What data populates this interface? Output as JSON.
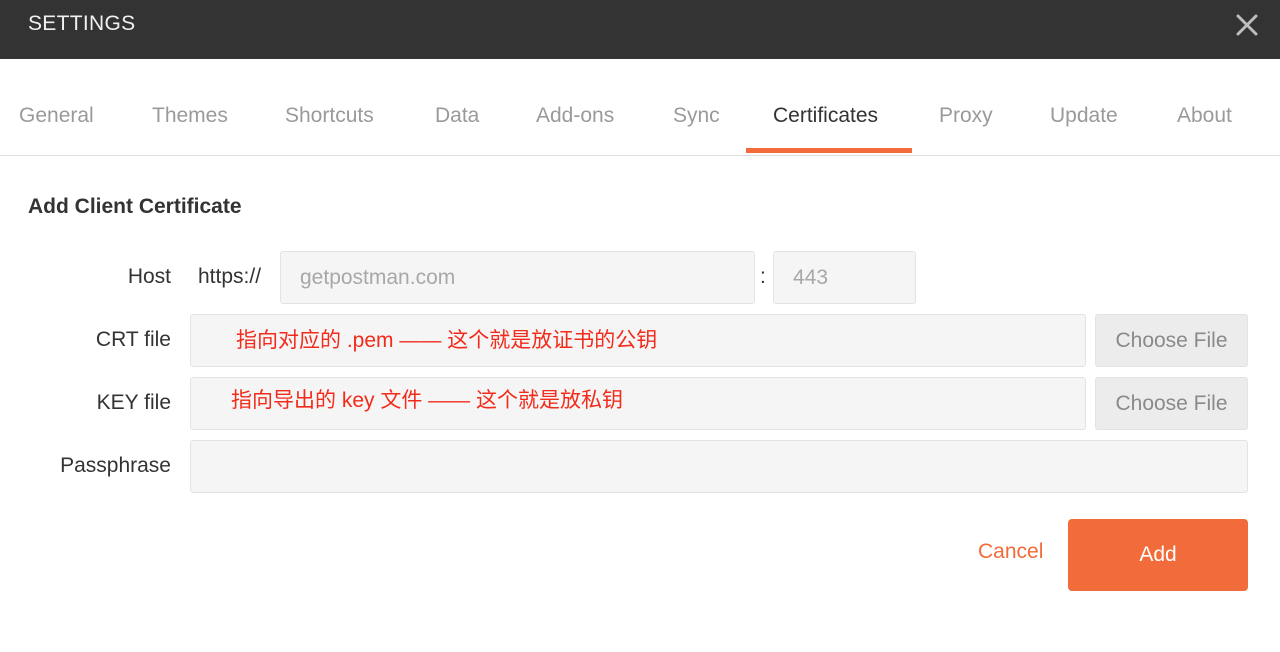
{
  "window": {
    "title": "SETTINGS",
    "close_icon": "close-icon"
  },
  "tabs": [
    {
      "label": "General"
    },
    {
      "label": "Themes"
    },
    {
      "label": "Shortcuts"
    },
    {
      "label": "Data"
    },
    {
      "label": "Add-ons"
    },
    {
      "label": "Sync"
    },
    {
      "label": "Certificates",
      "active": true
    },
    {
      "label": "Proxy"
    },
    {
      "label": "Update"
    },
    {
      "label": "About"
    }
  ],
  "form": {
    "section_title": "Add Client Certificate",
    "host": {
      "label": "Host",
      "prefix": "https://",
      "placeholder": "getpostman.com",
      "separator": ":",
      "port_placeholder": "443"
    },
    "crt": {
      "label": "CRT file",
      "annotation": "指向对应的 .pem  —— 这个就是放证书的公钥",
      "button": "Choose File"
    },
    "key": {
      "label": "KEY file",
      "annotation": "指向导出的 key 文件  —— 这个就是放私钥",
      "button": "Choose File"
    },
    "passphrase": {
      "label": "Passphrase",
      "value": ""
    }
  },
  "actions": {
    "cancel": "Cancel",
    "add": "Add"
  },
  "colors": {
    "accent": "#f26b3a",
    "titlebar": "#333333",
    "annotation": "#f22b1b"
  }
}
